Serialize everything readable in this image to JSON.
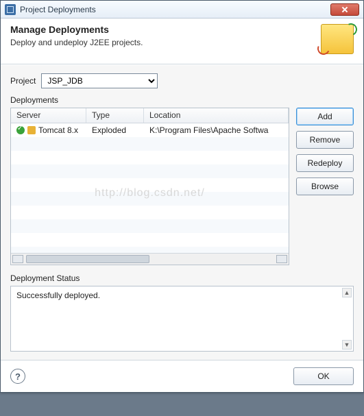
{
  "window": {
    "title": "Project Deployments"
  },
  "header": {
    "title": "Manage Deployments",
    "subtitle": "Deploy and undeploy J2EE projects."
  },
  "project": {
    "label": "Project",
    "selected": "JSP_JDB",
    "options": [
      "JSP_JDB"
    ]
  },
  "deployments": {
    "label": "Deployments",
    "columns": {
      "server": "Server",
      "type": "Type",
      "location": "Location"
    },
    "rows": [
      {
        "server": "Tomcat  8.x",
        "type": "Exploded",
        "location": "K:\\Program Files\\Apache Softwa"
      }
    ]
  },
  "buttons": {
    "add": "Add",
    "remove": "Remove",
    "redeploy": "Redeploy",
    "browse": "Browse",
    "ok": "OK"
  },
  "status": {
    "label": "Deployment Status",
    "message": "Successfully deployed."
  },
  "watermark": "http://blog.csdn.net/"
}
